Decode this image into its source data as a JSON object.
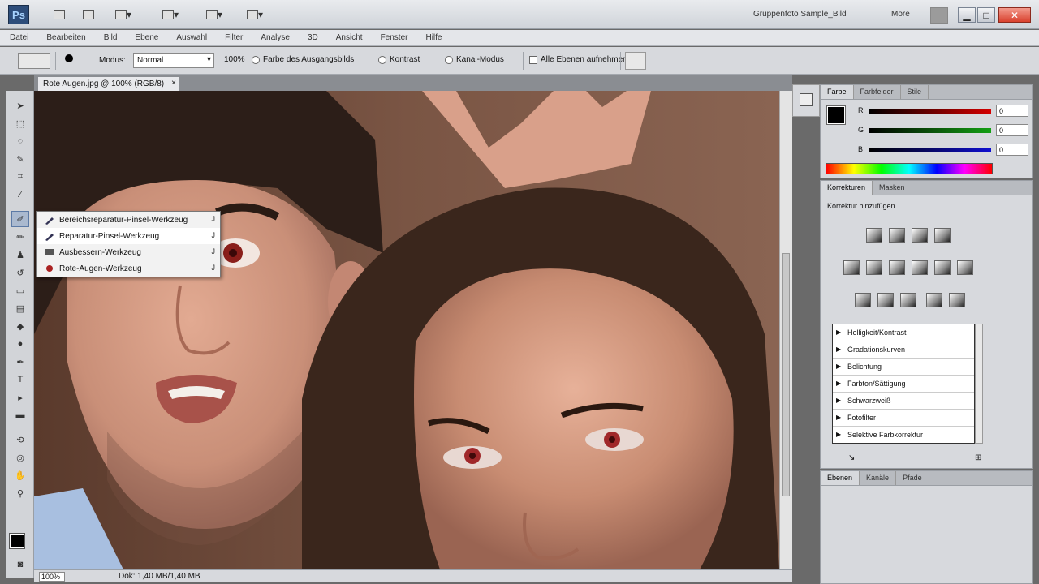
{
  "app": {
    "logo": "Ps"
  },
  "topbar": {
    "workspace": "Gruppenfoto Sample_Bild",
    "more": "More"
  },
  "menu": [
    "Datei",
    "Bearbeiten",
    "Bild",
    "Ebene",
    "Auswahl",
    "Filter",
    "Analyse",
    "3D",
    "Ansicht",
    "Fenster",
    "Hilfe"
  ],
  "options": {
    "mode_label": "Modus:",
    "mode_value": "Normal",
    "opacity": "100%",
    "chk1": "Farbe des Ausgangsbilds",
    "chk2": "Kontrast",
    "chk3": "Kanal-Modus",
    "chk4": "Alle Ebenen aufnehmen"
  },
  "document": {
    "tab_title": "Rote Augen.jpg @ 100% (RGB/8)",
    "close": "×",
    "zoom": "100%",
    "info": "Dok: 1,40 MB/1,40 MB"
  },
  "flyout": {
    "items": [
      {
        "label": "Bereichsreparatur-Pinsel-Werkzeug",
        "key": "J"
      },
      {
        "label": "Reparatur-Pinsel-Werkzeug",
        "key": "J"
      },
      {
        "label": "Ausbessern-Werkzeug",
        "key": "J"
      },
      {
        "label": "Rote-Augen-Werkzeug",
        "key": "J"
      }
    ]
  },
  "panels": {
    "color_tabs": [
      "Farbe",
      "Farbfelder",
      "Stile"
    ],
    "color": {
      "r_label": "R",
      "g_label": "G",
      "b_label": "B",
      "r": "0",
      "g": "0",
      "b": "0"
    },
    "adj_tabs": [
      "Korrekturen",
      "Masken"
    ],
    "adj_title": "Korrektur hinzufügen",
    "presets": [
      "Helligkeit/Kontrast",
      "Gradationskurven",
      "Belichtung",
      "Farbton/Sättigung",
      "Schwarzweiß",
      "Fotofilter",
      "Selektive Farbkorrektur"
    ],
    "layers_tabs": [
      "Ebenen",
      "Kanäle",
      "Pfade"
    ]
  },
  "colors": {
    "accent": "#5c7aa6",
    "red_slider": "#d40000",
    "green_slider": "#14a014",
    "blue_slider": "#1010d0"
  }
}
